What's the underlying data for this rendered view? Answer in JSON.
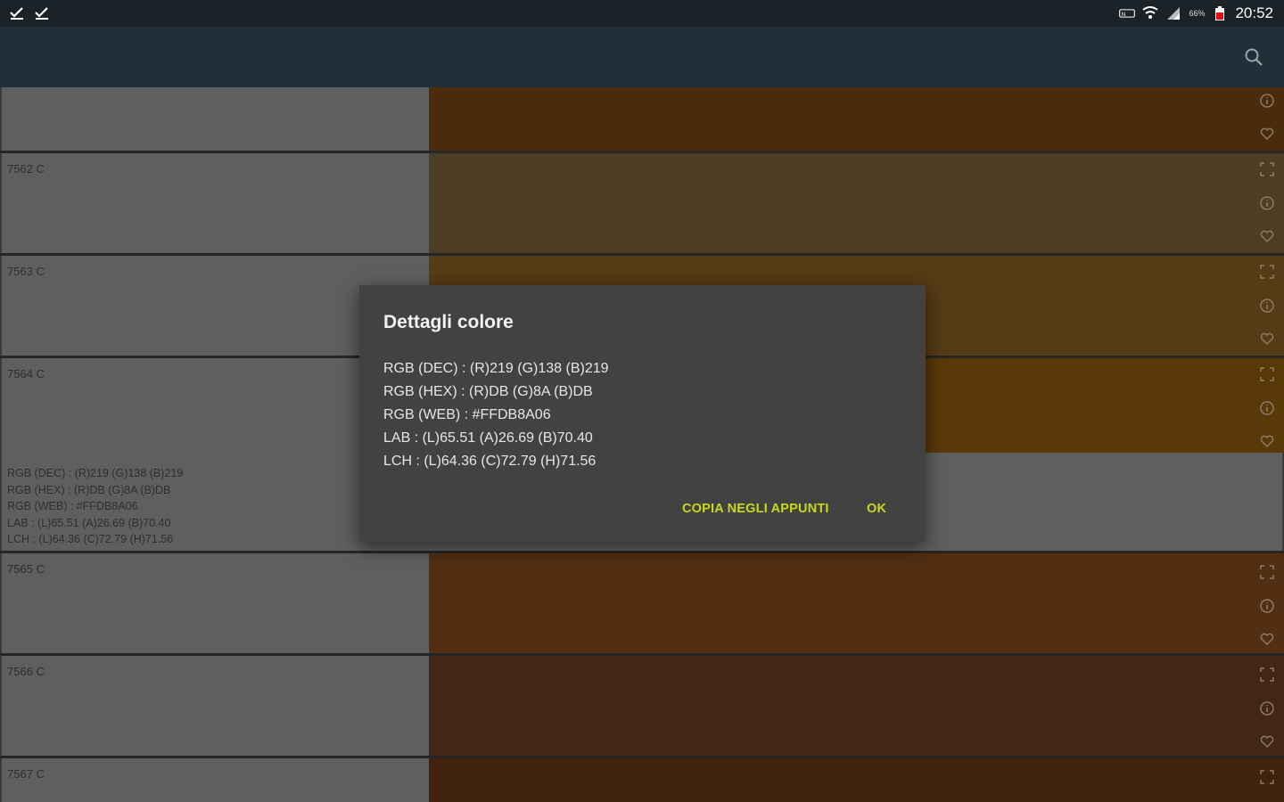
{
  "status_bar": {
    "battery_percent": "66%",
    "time": "20:52",
    "left_icons": [
      "check-download-icon",
      "check-download-icon"
    ],
    "right_icons": [
      "nfc-icon",
      "wifi-icon",
      "signal-icon",
      "battery-icon"
    ]
  },
  "app_bar": {
    "search_icon": "search-icon"
  },
  "rows": [
    {
      "name": "",
      "swatch_color": "#4a2c0c",
      "icons": [
        "info-icon",
        "favorite-icon"
      ]
    },
    {
      "name": "7562 C",
      "swatch_color": "#4d3d24",
      "icons": [
        "fullscreen-icon",
        "info-icon",
        "favorite-icon"
      ]
    },
    {
      "name": "7563 C",
      "swatch_color": "#553b16",
      "icons": [
        "fullscreen-icon",
        "info-icon",
        "favorite-icon"
      ]
    },
    {
      "name": "7564 C",
      "swatch_color": "#5a3908",
      "icons": [
        "fullscreen-icon",
        "info-icon",
        "favorite-icon"
      ],
      "details": [
        "RGB (DEC) : (R)219  (G)138  (B)219",
        "RGB (HEX) : (R)DB  (G)8A  (B)DB",
        "RGB (WEB) : #FFDB8A06",
        "LAB : (L)65.51  (A)26.69  (B)70.40",
        "LCH : (L)64.36  (C)72.79  (H)71.56"
      ]
    },
    {
      "name": "7565 C",
      "swatch_color": "#522e12",
      "icons": [
        "fullscreen-icon",
        "info-icon",
        "favorite-icon"
      ]
    },
    {
      "name": "7566 C",
      "swatch_color": "#422617",
      "icons": [
        "fullscreen-icon",
        "info-icon",
        "favorite-icon"
      ]
    },
    {
      "name": "7567 C",
      "swatch_color": "#40220f",
      "icons": [
        "fullscreen-icon"
      ]
    }
  ],
  "dialog": {
    "title": "Dettagli colore",
    "lines": [
      "RGB (DEC) : (R)219  (G)138  (B)219",
      "RGB (HEX) : (R)DB  (G)8A  (B)DB",
      "RGB (WEB) : #FFDB8A06",
      "LAB : (L)65.51  (A)26.69  (B)70.40",
      "LCH : (L)64.36  (C)72.79  (H)71.56"
    ],
    "copy_button": "COPIA NEGLI APPUNTI",
    "ok_button": "OK",
    "accent_color": "#c8d81a"
  }
}
